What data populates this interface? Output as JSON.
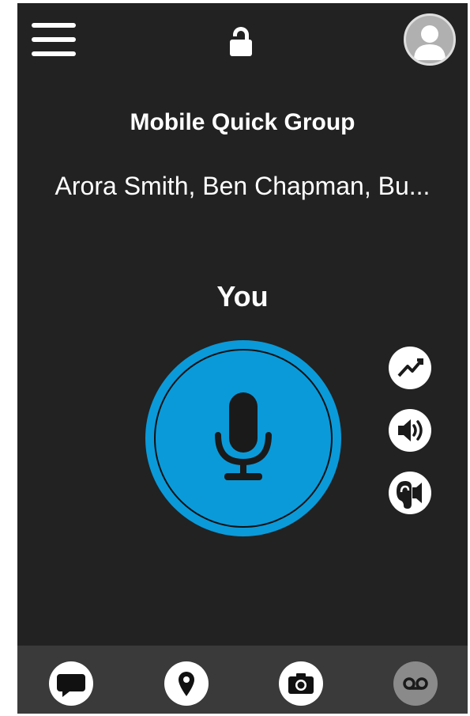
{
  "header": {
    "menu_icon": "hamburger-menu-icon",
    "lock_icon": "unlocked-padlock-icon",
    "avatar_icon": "user-avatar-icon"
  },
  "group": {
    "name": "Mobile Quick Group",
    "members": "Arora Smith, Ben Chapman, Bu..."
  },
  "talker": {
    "label": "You"
  },
  "ptt": {
    "icon": "microphone-icon",
    "color": "#0a9ad9"
  },
  "side_controls": [
    {
      "icon": "signal-strength-icon"
    },
    {
      "icon": "speaker-volume-icon"
    },
    {
      "icon": "earpiece-icon"
    }
  ],
  "bottom_nav": [
    {
      "icon": "chat-bubble-icon",
      "active": true
    },
    {
      "icon": "location-pin-icon",
      "active": true
    },
    {
      "icon": "camera-icon",
      "active": true
    },
    {
      "icon": "voicemail-icon",
      "active": false
    }
  ],
  "colors": {
    "background": "#222222",
    "bottom_bar": "#3a3a3a",
    "accent": "#0a9ad9",
    "disabled": "#8a8a8a"
  }
}
